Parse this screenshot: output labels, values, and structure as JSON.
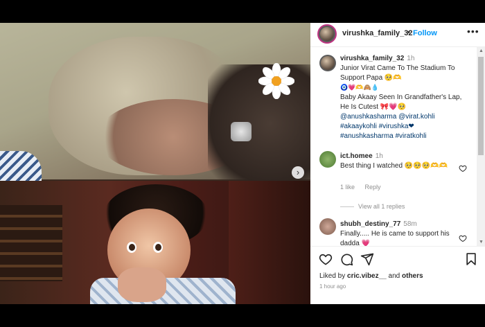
{
  "post": {
    "username": "virushka_family_32",
    "follow_label": "Follow",
    "more_label": "•••",
    "dot": "•"
  },
  "caption": {
    "username": "virushka_family_32",
    "timestamp": "1h",
    "line1": "Junior Virat Came To The Stadium To Support Papa 🥺🫶",
    "line2": "🧿💗🫶🙈💧",
    "line3": "Baby Akaay Seen In Grandfather's Lap, He Is Cutest 🎀💗🥺",
    "mentions": "@anushkasharma @virat.kohli",
    "hashtags1": "#akaaykohli #virushka❤",
    "hashtags2": "#anushkasharma #viratkohli"
  },
  "comments": [
    {
      "username": "ict.homee",
      "timestamp": "1h",
      "text": "Best thing I watched 🥺🥺🥺🫶🫶",
      "likes": "1 like",
      "reply_label": "Reply",
      "view_replies": "View all 1 replies"
    },
    {
      "username": "shubh_destiny_77",
      "timestamp": "58m",
      "text": "Finally..... He is came to support his dadda 💗"
    }
  ],
  "footer": {
    "liked_by_prefix": "Liked by",
    "liked_by_user": "cric.vibez__",
    "and_label": "and",
    "others_label": "others",
    "time": "1 hour ago"
  },
  "icons": [
    "heart-icon",
    "comment-icon",
    "share-icon",
    "bookmark-icon",
    "carousel-next-icon",
    "more-icon"
  ],
  "colors": {
    "follow": "#0095f6",
    "hashtag": "#00376b",
    "muted": "#8e8e8e",
    "text": "#262626"
  }
}
